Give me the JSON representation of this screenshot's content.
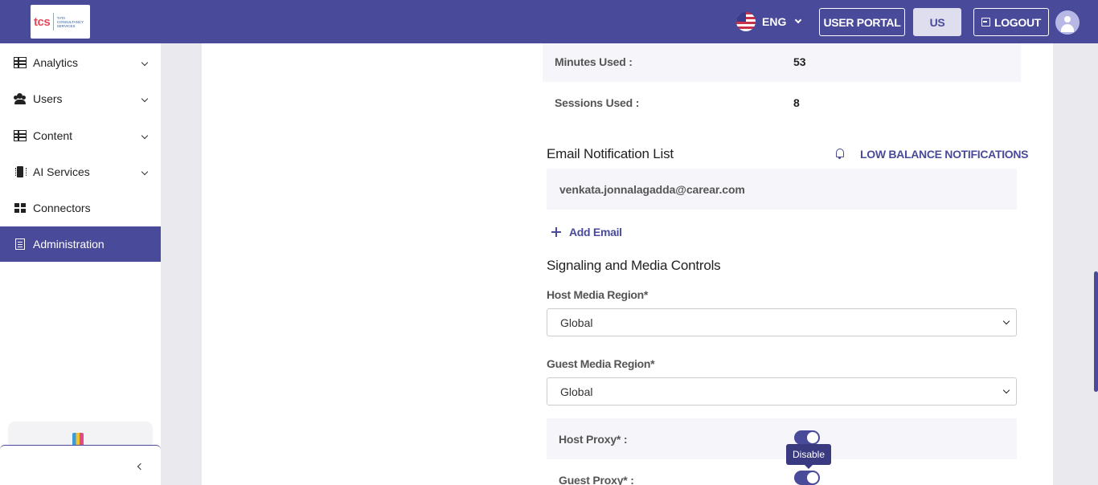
{
  "header": {
    "logo_text": "tcs",
    "logo_subtext": "TATA CONSULTANCY SERVICES",
    "language": "ENG",
    "user_portal_label": "USER PORTAL",
    "region_label": "US",
    "logout_label": "LOGOUT"
  },
  "sidebar": {
    "items": [
      {
        "label": "Analytics",
        "icon": "table-icon"
      },
      {
        "label": "Users",
        "icon": "users-icon"
      },
      {
        "label": "Content",
        "icon": "table-icon"
      },
      {
        "label": "AI Services",
        "icon": "chip-icon"
      },
      {
        "label": "Connectors",
        "icon": "grid-icon"
      },
      {
        "label": "Administration",
        "icon": "document-icon"
      }
    ],
    "active": "Administration"
  },
  "usage": {
    "minutes_label": "Minutes Used :",
    "minutes_value": "53",
    "sessions_label": "Sessions Used :",
    "sessions_value": "8"
  },
  "email_notifications": {
    "title": "Email Notification List",
    "low_balance_link": "LOW BALANCE NOTIFICATIONS",
    "emails": [
      "venkata.jonnalagadda@carear.com"
    ],
    "add_email_label": "Add Email"
  },
  "signaling": {
    "title": "Signaling and Media Controls",
    "host_media_region_label": "Host Media Region*",
    "host_media_region_value": "Global",
    "guest_media_region_label": "Guest Media Region*",
    "guest_media_region_value": "Global",
    "host_proxy_label": "Host Proxy* :",
    "host_proxy_enabled": true,
    "guest_proxy_label": "Guest Proxy* :",
    "guest_proxy_enabled": true,
    "tooltip_text": "Disable"
  },
  "colors": {
    "brand": "#4a4a9a",
    "accent_light": "#dedeef"
  }
}
